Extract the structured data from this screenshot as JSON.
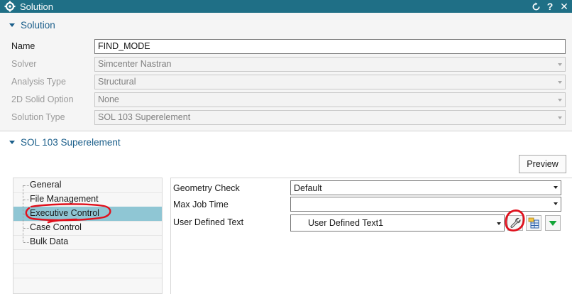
{
  "window": {
    "title": "Solution",
    "buttons": {
      "reset_icon": "reset-icon",
      "help": "?",
      "close": "✕"
    }
  },
  "solution_section": {
    "title": "Solution",
    "rows": [
      {
        "label": "Name",
        "value": "FIND_MODE",
        "enabled": true
      },
      {
        "label": "Solver",
        "value": "Simcenter Nastran",
        "enabled": false
      },
      {
        "label": "Analysis Type",
        "value": "Structural",
        "enabled": false
      },
      {
        "label": "2D Solid Option",
        "value": "None",
        "enabled": false
      },
      {
        "label": "Solution Type",
        "value": "SOL 103 Superelement",
        "enabled": false
      }
    ]
  },
  "sol_section": {
    "title": "SOL 103 Superelement",
    "preview_label": "Preview",
    "tree": {
      "items": [
        {
          "label": "General"
        },
        {
          "label": "File Management"
        },
        {
          "label": "Executive Control",
          "selected": true
        },
        {
          "label": "Case Control"
        },
        {
          "label": "Bulk Data"
        }
      ]
    },
    "props": {
      "geometry_check": {
        "label": "Geometry Check",
        "value": "Default"
      },
      "max_job_time": {
        "label": "Max Job Time",
        "value": ""
      },
      "user_defined_text": {
        "label": "User Defined Text",
        "value": "User Defined Text1"
      }
    }
  },
  "colors": {
    "titlebar": "#1f6f86",
    "section_title": "#1a5e8a",
    "selection": "#8fc6d4",
    "annotation": "#e0101c"
  }
}
